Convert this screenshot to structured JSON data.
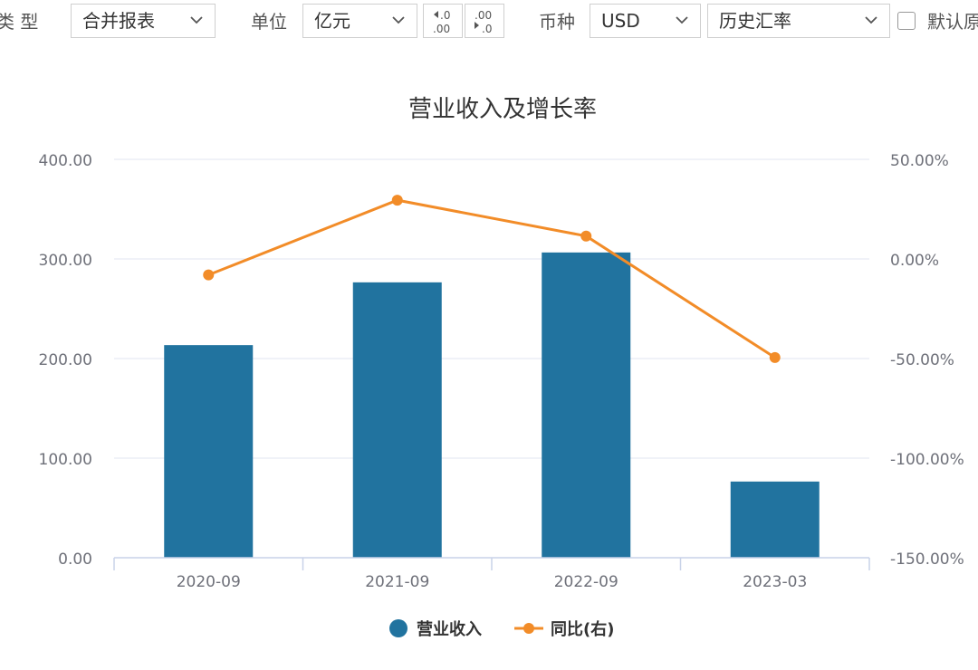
{
  "toolbar": {
    "type_label": "类 型",
    "type_value": "合并报表",
    "unit_label": "单位",
    "unit_value": "亿元",
    "dec_decrease_label": "←.0 .00",
    "dec_increase_label": ".00 →.0",
    "currency_label": "币种",
    "currency_value": "USD",
    "rate_value": "历史汇率",
    "default_label": "默认原"
  },
  "chart_data": {
    "type": "bar",
    "title": "营业收入及增长率",
    "categories": [
      "2020-09",
      "2021-09",
      "2022-09",
      "2023-03"
    ],
    "series": [
      {
        "name": "营业收入",
        "type": "bar",
        "axis": "left",
        "color": "#21739f",
        "values": [
          213.5,
          276.5,
          306.5,
          76.5
        ]
      },
      {
        "name": "同比(右)",
        "type": "line",
        "axis": "right",
        "color": "#f28c28",
        "values": [
          -8.0,
          29.5,
          11.5,
          -49.5
        ]
      }
    ],
    "left_axis": {
      "ylim": [
        0,
        400
      ],
      "ticks": [
        "0.00",
        "100.00",
        "200.00",
        "300.00",
        "400.00"
      ]
    },
    "right_axis": {
      "ylim": [
        -150,
        50
      ],
      "ticks": [
        "-150.00%",
        "-100.00%",
        "-50.00%",
        "0.00%",
        "50.00%"
      ]
    },
    "legend_position": "bottom-center",
    "grid": true
  }
}
